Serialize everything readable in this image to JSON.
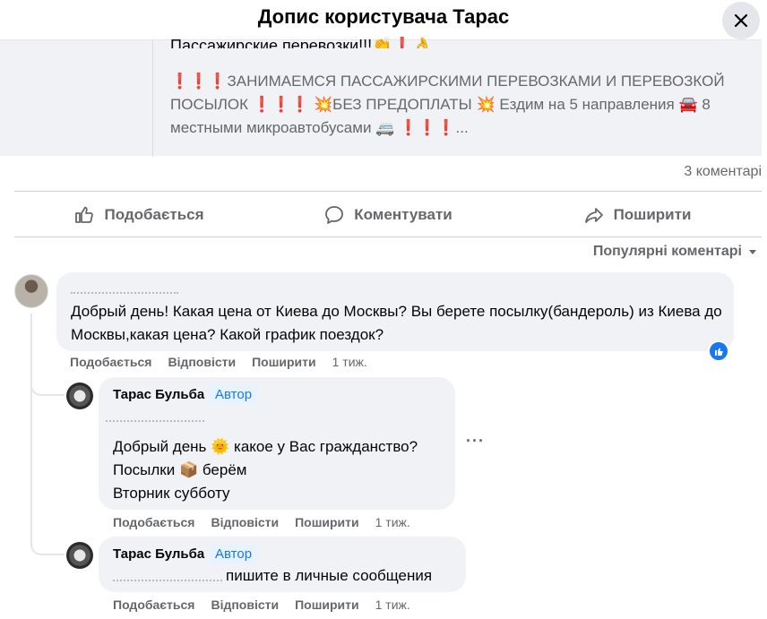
{
  "header": {
    "title": "Допис користувача Тарас"
  },
  "shared_post": {
    "title": "Пассажирские перевозки!!!👏❗👌",
    "body": "❗❗❗ЗАНИМАЕМСЯ ПАССАЖИРСКИМИ ПЕРЕВОЗКАМИ И ПЕРЕВОЗКОЙ ПОСЫЛОК ❗❗❗ 💥БЕЗ ПРЕДОПЛАТЫ 💥 Ездим на 5 направления 🚘 8 местными микроавтобусами 🚐 ❗❗❗..."
  },
  "post_stats": {
    "comment_count": "3 коментарі"
  },
  "actions": {
    "like": "Подобається",
    "comment": "Коментувати",
    "share": "Поширити"
  },
  "sort": {
    "label": "Популярні коментарі"
  },
  "comments": [
    {
      "text": "Добрый день! Какая цена от Киева до Москвы? Вы берете посылку(бандероль) из Киева до Москвы,какая цена? Какой график поездок?",
      "like": "Подобається",
      "reply": "Відповісти",
      "share": "Поширити",
      "time": "1 тиж."
    },
    {
      "author": "Тарас Бульба",
      "badge": "Автор",
      "text": "Добрый день 🌞 какое у Вас гражданство?\nПосылки 📦 берём\nВторник субботу",
      "like": "Подобається",
      "reply": "Відповісти",
      "share": "Поширити",
      "time": "1 тиж."
    },
    {
      "author": "Тарас Бульба",
      "badge": "Автор",
      "text": "пишите в личные сообщения",
      "like": "Подобається",
      "reply": "Відповісти",
      "share": "Поширити",
      "time": "1 тиж."
    }
  ],
  "colors": {
    "accent": "#1877f2",
    "bubble": "#f0f2f5",
    "muted": "#65676b"
  }
}
